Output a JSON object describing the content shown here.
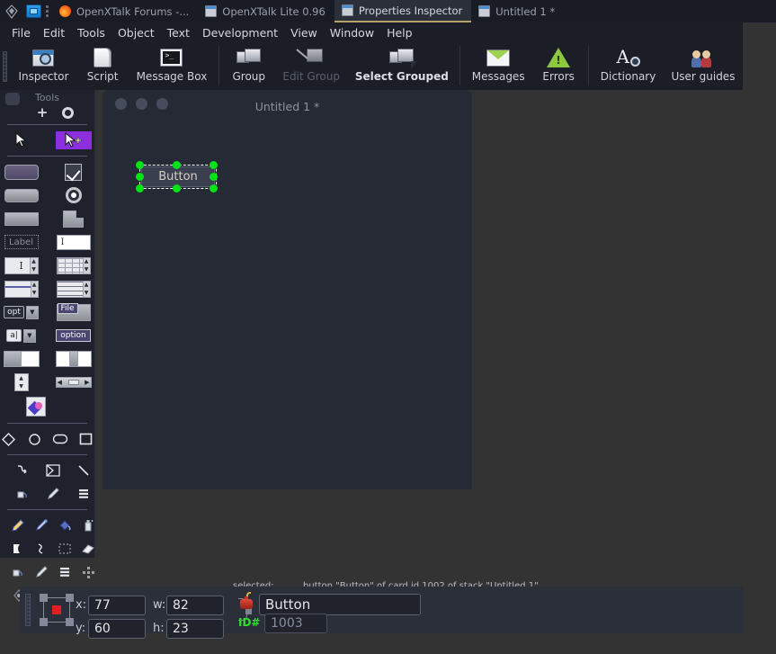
{
  "taskbar": {
    "tabs": [
      {
        "label": "OpenXTalk Forums -...",
        "icon": "firefox-icon",
        "active": false
      },
      {
        "label": "OpenXTalk Lite 0.96",
        "icon": "window-icon",
        "active": false
      },
      {
        "label": "Properties Inspector",
        "icon": "window-icon",
        "active": true
      },
      {
        "label": "Untitled 1 *",
        "icon": "window-icon",
        "active": false
      }
    ]
  },
  "menubar": {
    "items": [
      "File",
      "Edit",
      "Tools",
      "Object",
      "Text",
      "Development",
      "View",
      "Window",
      "Help"
    ]
  },
  "toolbar": {
    "buttons": [
      {
        "label": "Inspector",
        "icon": "inspector-window-icon",
        "state": "normal"
      },
      {
        "label": "Script",
        "icon": "script-scroll-icon",
        "state": "normal"
      },
      {
        "label": "Message Box",
        "icon": "terminal-icon",
        "state": "normal"
      },
      {
        "label": "Group",
        "icon": "group-icon",
        "state": "normal"
      },
      {
        "label": "Edit Group",
        "icon": "edit-group-icon",
        "state": "disabled"
      },
      {
        "label": "Select Grouped",
        "icon": "select-grouped-icon",
        "state": "bold"
      },
      {
        "label": "Messages",
        "icon": "envelope-icon",
        "state": "normal"
      },
      {
        "label": "Errors",
        "icon": "warning-triangle-icon",
        "state": "normal"
      },
      {
        "label": "Dictionary",
        "icon": "dictionary-icon",
        "state": "normal"
      },
      {
        "label": "User guides",
        "icon": "users-icon",
        "state": "normal"
      }
    ]
  },
  "tools_palette": {
    "title": "Tools",
    "add_label": "+",
    "settings_icon": "gear-icon",
    "pointer_tools": [
      {
        "name": "browse-pointer-tool",
        "selected": false
      },
      {
        "name": "edit-pointer-tool",
        "selected": true
      }
    ],
    "control_tools": [
      "push-button-tool",
      "checkbox-tool",
      "rounded-button-tool",
      "radio-button-tool",
      "rectangle-button-tool",
      "tab-button-tool",
      "label-field-tool",
      "text-field-tool",
      "scrolling-field-tool",
      "table-field-tool",
      "list-header-field-tool",
      "list-field-tool",
      "option-menu-tool",
      "file-menu-tool",
      "combobox-tool",
      "option-button-tool",
      "group-panel-tool",
      "split-panel-tool",
      "spinner-tool",
      "scrollbar-tool",
      "image-tool"
    ],
    "shape_tools": [
      "polygon-tool",
      "oval-tool",
      "rounded-rect-tool",
      "rectangle-tool"
    ],
    "line_tools": [
      "curve-tool",
      "freehand-polygon-tool",
      "line-tool"
    ],
    "paint_row": [
      "bucket-tool",
      "brush-tool",
      "pattern-tool"
    ],
    "paint_tools": [
      "pencil-tool",
      "airbrush-tool",
      "paint-bucket-tool",
      "spray-can-tool",
      "lasso-tool",
      "curve-draw-tool",
      "select-rect-tool",
      "eraser-tool",
      "stamp-tool",
      "brush2-tool",
      "lines-tool",
      "dither-tool",
      "target-tool"
    ]
  },
  "card_window": {
    "title": "Untitled 1 *",
    "button": {
      "label": "Button",
      "selected": true
    }
  },
  "inspector": {
    "selected_label": "selected:",
    "selected_description": "button \"Button\" of card id 1002 of stack \"Untitled 1\"",
    "fields": {
      "x_label": "x:",
      "x_value": "77",
      "y_label": "y:",
      "y_value": "60",
      "w_label": "w:",
      "w_value": "82",
      "h_label": "h:",
      "h_value": "23",
      "name_value": "Button",
      "id_label": "ID#",
      "id_value": "1003"
    },
    "icons": {
      "geometry": "geometry-anchor-icon",
      "link": "link-constrain-icon",
      "name": "bomb-icon"
    }
  },
  "colors": {
    "desktop": "#333333",
    "chrome": "#1b1e27",
    "panel": "#2b2f3a",
    "accent_tab": "#b9a06a",
    "selection_handle": "#00e317",
    "tool_selected": "#8b2fe0",
    "id_green": "#2ee02e"
  }
}
